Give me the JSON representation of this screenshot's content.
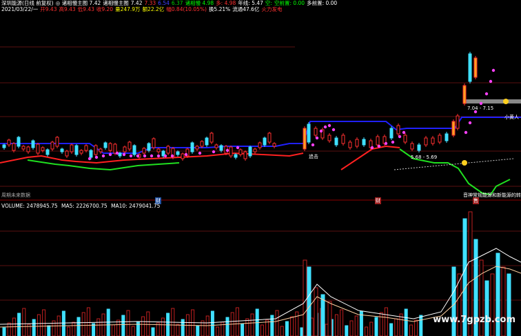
{
  "header": {
    "line1": [
      {
        "text": "深圳能源(日线 前复权)",
        "color": "#ffffff"
      },
      {
        "text": "◎ 诸相慢主图 7.42",
        "color": "#ffffff"
      },
      {
        "text": "诸相慢主图",
        "color": "#ffffff"
      },
      {
        "text": "7.42",
        "color": "#ffffff"
      },
      {
        "text": "7.33",
        "color": "#ff3030"
      },
      {
        "text": "6.54",
        "color": "#4040ff"
      },
      {
        "text": "6.37",
        "color": "#00cc00"
      },
      {
        "text": "诸相慢 4.98",
        "color": "#00ff00"
      },
      {
        "text": "多: 4.98",
        "color": "#ff3030"
      },
      {
        "text": "年线: 5.47",
        "color": "#ffffff"
      },
      {
        "text": "空:",
        "color": "#00ff00"
      },
      {
        "text": "空前置: 0.00",
        "color": "#00ff00"
      },
      {
        "text": "多前置: 0.00",
        "color": "#ffffff"
      }
    ],
    "line2": [
      {
        "text": "2021/03/22/一",
        "color": "#ffffff"
      },
      {
        "text": "开9.43",
        "color": "#ff3030"
      },
      {
        "text": "高9.43",
        "color": "#ff3030"
      },
      {
        "text": "低9.43",
        "color": "#ff3030"
      },
      {
        "text": "收9.20",
        "color": "#ff3030"
      },
      {
        "text": "量247.9万",
        "color": "#ffff00"
      },
      {
        "text": "额22.2亿",
        "color": "#ffff00"
      },
      {
        "text": "幅0.84(10.05%)",
        "color": "#ff3030"
      },
      {
        "text": "换5.21%",
        "color": "#ffffff"
      },
      {
        "text": "流通47.6亿",
        "color": "#ffffff"
      },
      {
        "text": "火力发电",
        "color": "#ff3030"
      }
    ]
  },
  "annotations": {
    "no_data": "周期未来数据",
    "top_price": "7.15",
    "right_tag": "小黄人",
    "range1": "7.04 - 7.15",
    "range2": "5.68 - 5.69",
    "attack": "追击",
    "note_bottom": "音神常规能源和新能源的转",
    "fin1": "财",
    "fin2": "财",
    "fin3": "售"
  },
  "volume": {
    "label": "VOLUME: 2478945.75",
    "ma5": "MA5: 2226700.75",
    "ma10": "MA10: 2479041.75"
  },
  "watermark": "www.7gpzb.com"
}
